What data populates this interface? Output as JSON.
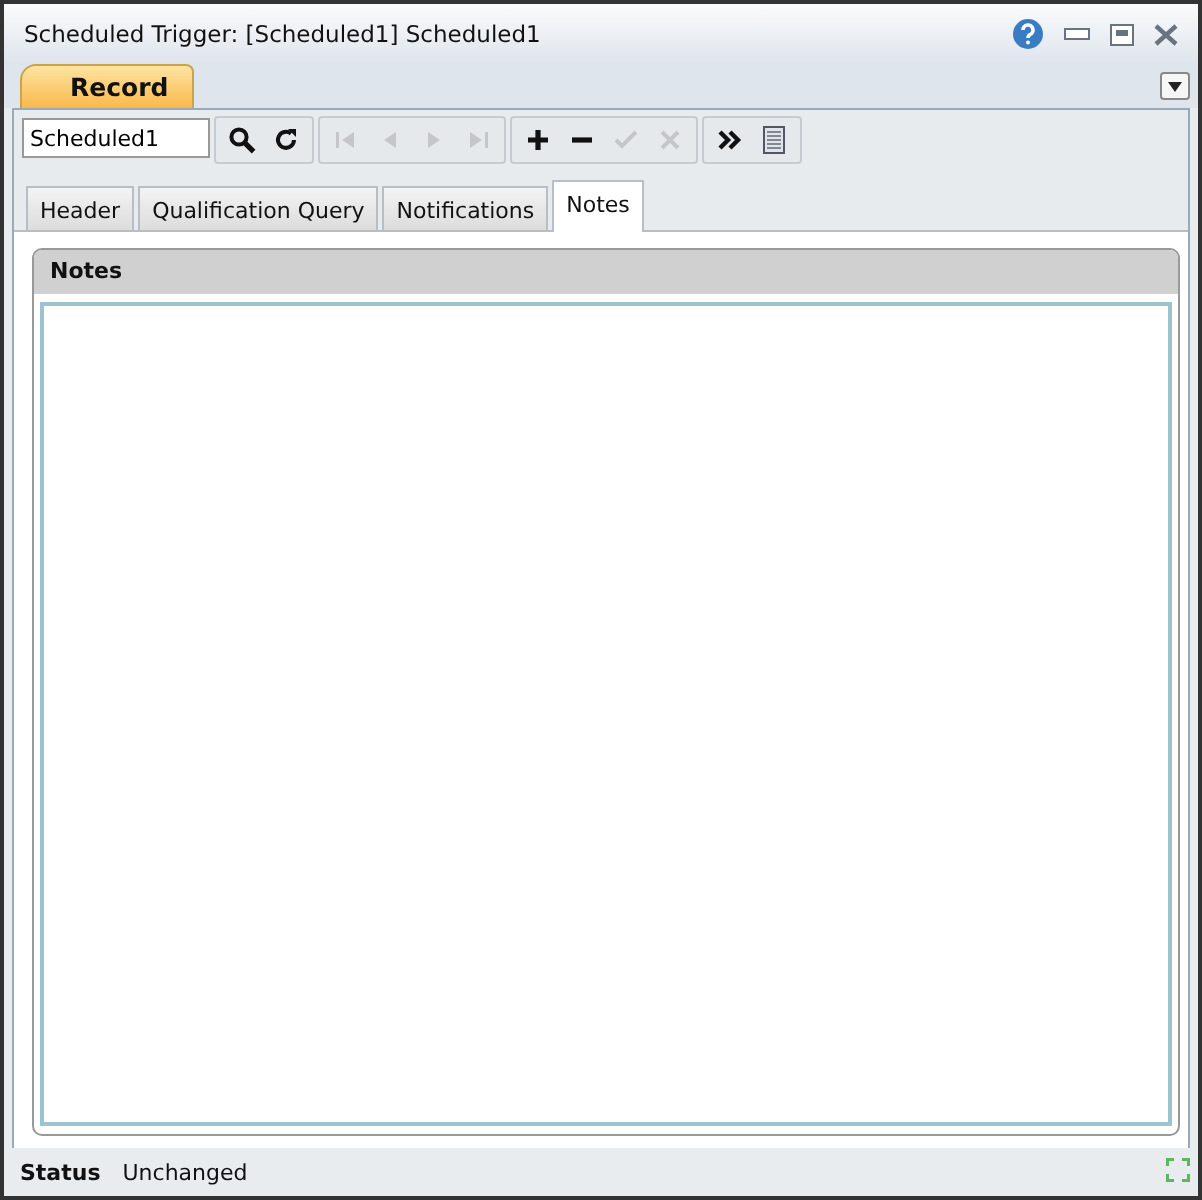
{
  "window": {
    "title": "Scheduled Trigger: [Scheduled1] Scheduled1"
  },
  "ribbon_tab": {
    "label": "Record",
    "selected": true
  },
  "toolbar": {
    "field_value": "Scheduled1",
    "groups": [
      [
        {
          "kind": "search",
          "disabled": false
        },
        {
          "kind": "refresh",
          "disabled": false
        }
      ],
      [
        {
          "kind": "first",
          "disabled": true
        },
        {
          "kind": "previous",
          "disabled": true
        },
        {
          "kind": "next",
          "disabled": true
        },
        {
          "kind": "last",
          "disabled": true
        }
      ],
      [
        {
          "kind": "add",
          "disabled": false
        },
        {
          "kind": "remove",
          "disabled": false
        },
        {
          "kind": "confirm",
          "disabled": true
        },
        {
          "kind": "cancel",
          "disabled": true
        }
      ],
      [
        {
          "kind": "more",
          "disabled": false
        },
        {
          "kind": "list",
          "disabled": false
        }
      ]
    ]
  },
  "tabs": [
    {
      "label": "Header",
      "selected": false
    },
    {
      "label": "Qualification Query",
      "selected": false
    },
    {
      "label": "Notifications",
      "selected": false
    },
    {
      "label": "Notes",
      "selected": true
    }
  ],
  "panel": {
    "title": "Notes"
  },
  "status_bar": {
    "label": "Status",
    "value": "Unchanged"
  }
}
